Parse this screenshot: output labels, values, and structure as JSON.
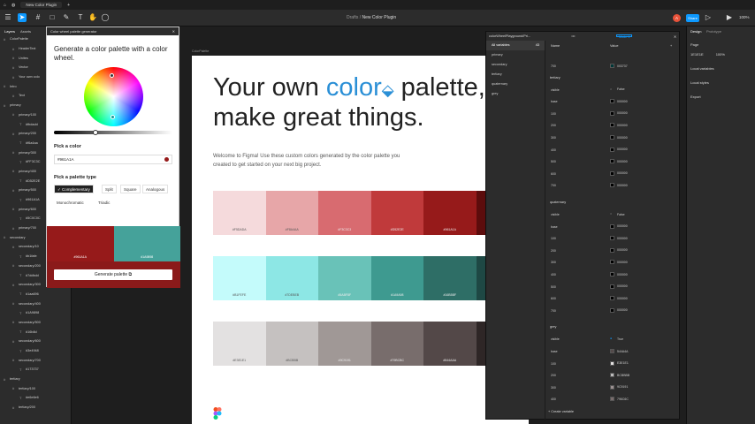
{
  "topbar": {
    "tab": "New Color Plugin"
  },
  "toolbar": {
    "crumb_prefix": "Drafts",
    "crumb_sep": "/",
    "crumb_file": "New Color Plugin",
    "share": "Share",
    "avatar": "A",
    "zoom": "100%"
  },
  "layers": {
    "tab_layers": "Layers",
    "tab_assets": "Assets",
    "items": [
      "ColorPalette",
      "HeaderText",
      "Unites",
      "Vector",
      "Your own colo",
      "Intro",
      "Text",
      "primary",
      "primary/100",
      "#fbdadd",
      "primary/200",
      "#f6a4aa",
      "primary/300",
      "#FF3C3C",
      "primary/400",
      "#D52E2E",
      "primary/500",
      "#961A1A",
      "primary/600",
      "#5C0C0C",
      "primary/700",
      "secondary",
      "secondary/10",
      "#b1fafe",
      "secondary/200",
      "#7ddbdd",
      "secondary/300",
      "#1aa696",
      "secondary/400",
      "#1A9898",
      "secondary/500",
      "#16b8d",
      "secondary/600",
      "#3e4948",
      "secondary/700",
      "#173737",
      "tertiary",
      "tertiary/100",
      "#e6e6e6",
      "tertiary/200"
    ]
  },
  "canvas": {
    "frame_label": "ColorPalette"
  },
  "hero": {
    "line1": "Your own ",
    "accent": "color",
    "line1b": " palette,",
    "line2": "make great things."
  },
  "welcome": "Welcome to Figma! Use these custom colors generated by the color palette you created to get started on your next big project.",
  "swatches": {
    "primary": [
      {
        "hex": "#F5DADA",
        "color": "#f5dadc"
      },
      {
        "hex": "#F8A4AA",
        "color": "#e7a6a8"
      },
      {
        "hex": "#F3C3C3",
        "color": "#d86b70"
      },
      {
        "hex": "#D52E2E",
        "color": "#c03a3b"
      },
      {
        "hex": "#961A1A",
        "color": "#961a1a"
      },
      {
        "hex": "#5C0C0C",
        "color": "#5c0c0c"
      }
    ],
    "secondary": [
      {
        "hex": "#B1FEFE",
        "color": "#c4fbfb"
      },
      {
        "hex": "#7DEBEB",
        "color": "#8de7e5"
      },
      {
        "hex": "#5ABF8F",
        "color": "#69c2b8"
      },
      {
        "hex": "#1A9A98",
        "color": "#3e9a90"
      },
      {
        "hex": "#16B5BF",
        "color": "#2e6e66"
      },
      {
        "hex": "#3E4949",
        "color": "#1e4844"
      }
    ],
    "tertiary": [
      {
        "hex": "#E3E1E1",
        "color": "#e3e1e1"
      },
      {
        "hex": "#BCBBB",
        "color": "#c5c1c0"
      },
      {
        "hex": "#9C9191",
        "color": "#a09896"
      },
      {
        "hex": "#79BCBC",
        "color": "#786d6c"
      },
      {
        "hex": "#544AAA",
        "color": "#534848"
      },
      {
        "hex": "#313B2B",
        "color": "#2e2626"
      }
    ]
  },
  "plugin": {
    "header": "Color wheel palette generator",
    "title": "Generate a color palette with a color wheel.",
    "pick_color": "Pick a color",
    "hex_value": "#961A1A",
    "pick_type": "Pick a palette type",
    "types": [
      "Complementary",
      "Split",
      "Square",
      "Analogous"
    ],
    "types2": [
      "Monochromatic",
      "Triadic"
    ],
    "preview_left": "#961A1A",
    "preview_right": "#1A9898",
    "generate": "Generate palette"
  },
  "variables": {
    "title": "colorWheelPlayground/Pri...",
    "collections": [
      "All variables",
      "primary",
      "secondary",
      "tertiary",
      "quaternary",
      "grey"
    ],
    "all_count": "43",
    "col_name": "Name",
    "col_value": "Value",
    "mode": "Mode 1",
    "create": "+ Create variable",
    "top_rows": [
      {
        "name": "700",
        "value": "003737"
      }
    ],
    "tertiary_label": "tertiary",
    "tertiary_rows": [
      {
        "name": "visible",
        "value": "False"
      },
      {
        "name": "base",
        "value": "000000"
      },
      {
        "name": "100",
        "value": "000000"
      },
      {
        "name": "200",
        "value": "000000"
      },
      {
        "name": "300",
        "value": "000000"
      },
      {
        "name": "400",
        "value": "000000"
      },
      {
        "name": "500",
        "value": "000000"
      },
      {
        "name": "600",
        "value": "000000"
      },
      {
        "name": "700",
        "value": "000000"
      }
    ],
    "quaternary_label": "quaternary",
    "quaternary_rows": [
      {
        "name": "visible",
        "value": "False"
      },
      {
        "name": "base",
        "value": "000000"
      },
      {
        "name": "100",
        "value": "000000"
      },
      {
        "name": "200",
        "value": "000000"
      },
      {
        "name": "300",
        "value": "000000"
      },
      {
        "name": "400",
        "value": "000000"
      },
      {
        "name": "500",
        "value": "000000"
      },
      {
        "name": "600",
        "value": "000000"
      },
      {
        "name": "700",
        "value": "000000"
      }
    ],
    "grey_label": "grey",
    "grey_rows": [
      {
        "name": "visible",
        "value": "True"
      },
      {
        "name": "base",
        "value": "544A4A"
      },
      {
        "name": "100",
        "value": "E3E1E1"
      },
      {
        "name": "200",
        "value": "BCBBBB"
      },
      {
        "name": "300",
        "value": "9C9191"
      },
      {
        "name": "400",
        "value": "796C6C"
      }
    ]
  },
  "props": {
    "tab_design": "Design",
    "tab_prototype": "Prototype",
    "page": "Page",
    "page_color": "1E1E1E",
    "page_pct": "100%",
    "local_vars": "Local variables",
    "local_styles": "Local styles",
    "export": "Export"
  }
}
